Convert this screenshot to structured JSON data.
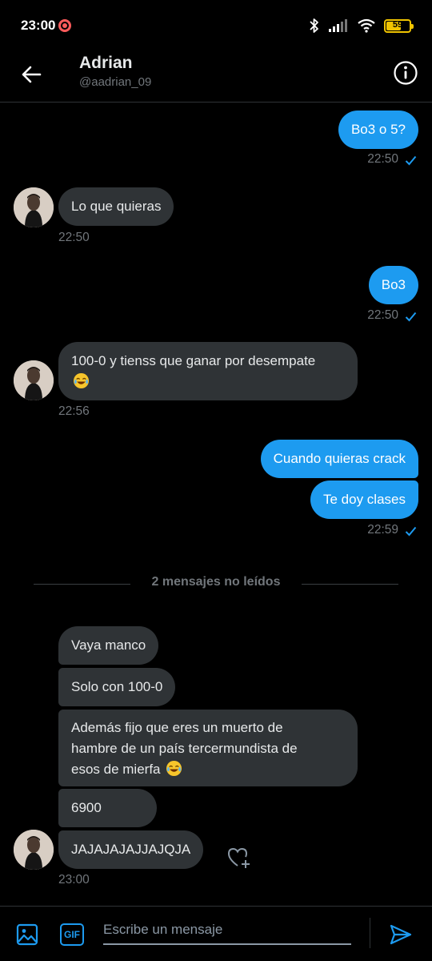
{
  "status_bar": {
    "time": "23:00",
    "battery": "59",
    "battery_level": 0.59
  },
  "header": {
    "name": "Adrian",
    "handle": "@aadrian_09"
  },
  "messages": [
    {
      "text": "Bo3 o 5?"
    },
    {
      "text": "Lo que quieras"
    },
    {
      "text": "Bo3"
    },
    {
      "line1": "100-0 y tienss que ganar por desempate",
      "emoji": "face-with-tears-of-joy"
    },
    {
      "text": "Cuando quieras crack"
    },
    {
      "text": "Te doy clases"
    },
    {
      "text": "Vaya manco"
    },
    {
      "text": "Solo con 100-0"
    },
    {
      "line1": "Además fijo que eres un muerto de",
      "line2": "hambre de un país tercermundista de",
      "line3": "esos de mierfa",
      "emoji": "face-with-tears-of-joy"
    },
    {
      "text": "6900"
    },
    {
      "text": "JAJAJAJAJJAJQJA"
    }
  ],
  "timestamps": [
    "22:50",
    "22:50",
    "22:50",
    "22:56",
    "22:59",
    "23:00"
  ],
  "unread_divider": "2 mensajes no leídos",
  "composer": {
    "placeholder": "Escribe un mensaje",
    "gif_label": "GIF"
  },
  "colors": {
    "accent": "#1d9bf0",
    "incoming_bubble": "#2f3336",
    "background": "#000000",
    "muted_text": "#71767b"
  },
  "icons": [
    "back-arrow-icon",
    "info-icon",
    "read-check-icon",
    "heart-plus-icon",
    "image-icon",
    "gif-icon",
    "send-icon"
  ]
}
